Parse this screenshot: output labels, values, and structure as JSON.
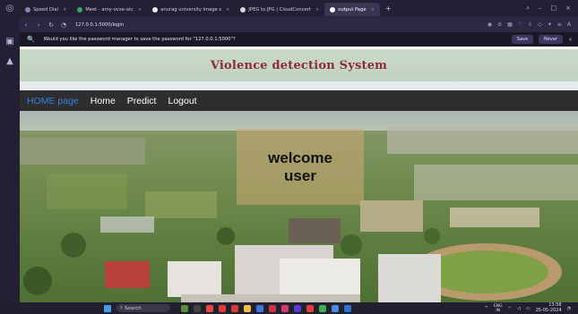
{
  "browser": {
    "tabs": [
      {
        "label": "Speed Dial",
        "active": false
      },
      {
        "label": "Meet - amy-ovxe-atc",
        "active": false
      },
      {
        "label": "anurag university image s",
        "active": false
      },
      {
        "label": "JPEG to JPG | CloudConvert",
        "active": false
      },
      {
        "label": "output Page",
        "active": true
      }
    ],
    "url": "127.0.0.1:5000/login",
    "password_prompt": "Would you like the password manager to save the password for \"127.0.0.1:5000\"?",
    "save_label": "Save",
    "never_label": "Never"
  },
  "site": {
    "title": "Violence detection System",
    "nav": {
      "home_page": "HOME page",
      "home": "Home",
      "predict": "Predict",
      "logout": "Logout"
    },
    "welcome_line1": "welcome",
    "welcome_line2": "user",
    "colors": {
      "title": "#8b2b3a",
      "navbar": "#2e2e2e",
      "nav_active": "#2f7fe0"
    }
  },
  "taskbar": {
    "search_label": "Search",
    "lang_line1": "ENG",
    "lang_line2": "IN",
    "time": "13:58",
    "date": "25-05-2024"
  }
}
